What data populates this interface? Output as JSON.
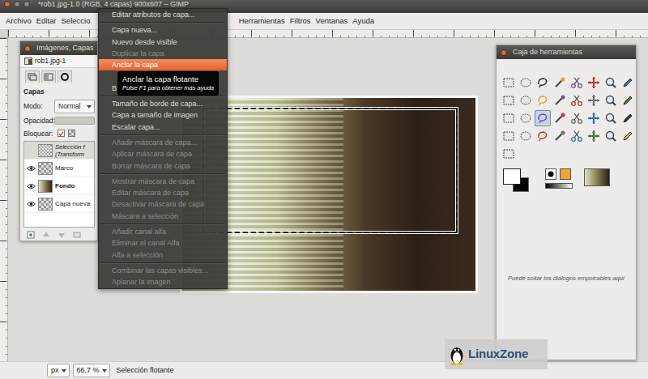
{
  "window": {
    "title": "*rob1.jpg-1.0 (RGB, 4 capas) 900x607 – GIMP"
  },
  "menubar": [
    {
      "label": "Archivo"
    },
    {
      "label": "Editar"
    },
    {
      "label": "Seleccio"
    },
    {
      "label": "Herramientas"
    },
    {
      "label": "Filtros"
    },
    {
      "label": "Ventanas"
    },
    {
      "label": "Ayuda"
    }
  ],
  "layer_menu": [
    {
      "kind": "item",
      "label": "Editar atributos de capa...",
      "disabled": false,
      "selected": false
    },
    {
      "kind": "separator"
    },
    {
      "kind": "item",
      "label": "Capa nueva...",
      "disabled": false,
      "selected": false
    },
    {
      "kind": "item",
      "label": "Nuevo desde visible",
      "disabled": false,
      "selected": false
    },
    {
      "kind": "item",
      "label": "Duplicar la capa",
      "disabled": true,
      "selected": false
    },
    {
      "kind": "item",
      "label": "Anclar la capa",
      "disabled": false,
      "selected": true
    },
    {
      "kind": "covered"
    },
    {
      "kind": "item",
      "label": "B",
      "disabled": false,
      "selected": false
    },
    {
      "kind": "separator"
    },
    {
      "kind": "item",
      "label": "Tamaño de borde de capa...",
      "disabled": false,
      "selected": false
    },
    {
      "kind": "item",
      "label": "Capa a tamaño de imagen",
      "disabled": false,
      "selected": false
    },
    {
      "kind": "item",
      "label": "Escalar capa...",
      "disabled": false,
      "selected": false
    },
    {
      "kind": "separator"
    },
    {
      "kind": "item",
      "label": "Añadir máscara de capa...",
      "disabled": true,
      "selected": false
    },
    {
      "kind": "item",
      "label": "Aplicar máscara de capa",
      "disabled": true,
      "selected": false
    },
    {
      "kind": "item",
      "label": "Borrar máscara de capa",
      "disabled": true,
      "selected": false
    },
    {
      "kind": "separator"
    },
    {
      "kind": "item",
      "label": "Mostrar máscara de capa",
      "disabled": true,
      "selected": false
    },
    {
      "kind": "item",
      "label": "Editar máscara de capa",
      "disabled": true,
      "selected": false
    },
    {
      "kind": "item",
      "label": "Desactivar máscara de capa",
      "disabled": true,
      "selected": false
    },
    {
      "kind": "item",
      "label": "Máscara a selección",
      "disabled": true,
      "selected": false
    },
    {
      "kind": "separator"
    },
    {
      "kind": "item",
      "label": "Añadir canal alfa",
      "disabled": true,
      "selected": false
    },
    {
      "kind": "item",
      "label": "Eliminar el canal Alfa",
      "disabled": true,
      "selected": false
    },
    {
      "kind": "item",
      "label": "Alfa a selección",
      "disabled": true,
      "selected": false
    },
    {
      "kind": "separator"
    },
    {
      "kind": "item",
      "label": "Combinar las capas visibles...",
      "disabled": true,
      "selected": false
    },
    {
      "kind": "item",
      "label": "Aplanar la imagen",
      "disabled": true,
      "selected": false
    }
  ],
  "tooltip": {
    "title": "Anclar la capa flotante",
    "hint": "Pulse F1 para obtener más ayuda"
  },
  "dock": {
    "title": "Imágenes, Capas",
    "image_tab": "rob1.jpg-1",
    "section": "Capas",
    "mode_label": "Modo:",
    "mode": "Normal",
    "opacity_label": "Opacidad:",
    "opacity": {
      "level": 1
    },
    "lock_label": "Bloquear:",
    "lock": {
      "checked": true
    },
    "layers": [
      {
        "name": "Selección f",
        "detail": "(Transform",
        "kind": "floating",
        "visible": false,
        "selected": true,
        "bold": false
      },
      {
        "name": "Marco",
        "kind": "transparent",
        "visible": true,
        "selected": false,
        "bold": false
      },
      {
        "name": "Fondo",
        "kind": "photo",
        "visible": true,
        "selected": false,
        "bold": true
      },
      {
        "name": "Capa nueva",
        "kind": "transparent",
        "visible": true,
        "selected": false,
        "bold": false
      }
    ]
  },
  "toolbox": {
    "title": "Caja de herramientas",
    "tools": [
      {
        "selected": false
      },
      {
        "selected": false
      },
      {
        "selected": false
      },
      {
        "selected": false
      },
      {
        "selected": false
      },
      {
        "selected": false
      },
      {
        "selected": false
      },
      {
        "selected": false
      },
      {
        "selected": false
      },
      {
        "selected": false
      },
      {
        "selected": false
      },
      {
        "selected": false
      },
      {
        "selected": false
      },
      {
        "selected": false
      },
      {
        "selected": false
      },
      {
        "selected": false
      },
      {
        "selected": false
      },
      {
        "selected": false
      },
      {
        "selected": true
      },
      {
        "selected": false
      },
      {
        "selected": false
      },
      {
        "selected": false
      },
      {
        "selected": false
      },
      {
        "selected": false
      },
      {
        "selected": false
      },
      {
        "selected": false
      },
      {
        "selected": false
      },
      {
        "selected": false
      },
      {
        "selected": false
      },
      {
        "selected": false
      },
      {
        "selected": false
      },
      {
        "selected": false
      },
      {
        "selected": false
      }
    ],
    "hint": "Puede soltar los diálogos empotrables aquí"
  },
  "status_bar": {
    "unit": "px",
    "zoom": "66,7 %",
    "message": "Selección flotante"
  },
  "watermark": {
    "text": "LinuxZone"
  }
}
